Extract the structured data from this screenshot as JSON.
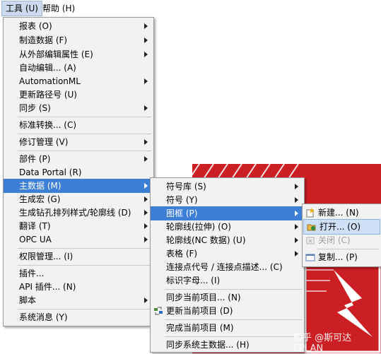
{
  "menubar": {
    "tools": "工具 (U)",
    "help": "帮助 (H)"
  },
  "tools_menu": [
    {
      "label": "报表 (O)",
      "sub": true
    },
    {
      "label": "制造数据 (F)",
      "sub": true
    },
    {
      "label": "从外部编辑属性 (E)",
      "sub": true
    },
    {
      "label": "自动编辑... (A)",
      "sub": false
    },
    {
      "label": "AutomationML",
      "sub": true
    },
    {
      "label": "更新路径号 (U)",
      "sub": false
    },
    {
      "label": "同步 (S)",
      "sub": true
    },
    {
      "label": "标准转换... (C)",
      "sub": false
    },
    {
      "label": "修订管理 (V)",
      "sub": true
    },
    {
      "label": "部件 (P)",
      "sub": true
    },
    {
      "label": "Data Portal (R)",
      "sub": false
    },
    {
      "label": "主数据 (M)",
      "sub": true
    },
    {
      "label": "生成宏 (G)",
      "sub": true
    },
    {
      "label": "生成钻孔排列样式/轮廓线 (D)",
      "sub": true
    },
    {
      "label": "翻译 (T)",
      "sub": true
    },
    {
      "label": "OPC UA",
      "sub": true
    },
    {
      "label": "权限管理... (I)",
      "sub": false
    },
    {
      "label": "插件...",
      "sub": false
    },
    {
      "label": "API 插件... (N)",
      "sub": false
    },
    {
      "label": "脚本",
      "sub": true
    },
    {
      "label": "系统消息 (Y)",
      "sub": false
    }
  ],
  "master_menu": [
    {
      "label": "符号库 (S)",
      "sub": true
    },
    {
      "label": "符号 (Y)",
      "sub": true
    },
    {
      "label": "图框 (P)",
      "sub": true
    },
    {
      "label": "轮廓线(拉伸) (O)",
      "sub": true
    },
    {
      "label": "轮廓线(NC 数据) (U)",
      "sub": true
    },
    {
      "label": "表格 (F)",
      "sub": true
    },
    {
      "label": "连接点代号 / 连接点描述... (C)",
      "sub": false
    },
    {
      "label": "标识字母... (I)",
      "sub": false
    },
    {
      "label": "同步当前项目... (N)",
      "sub": false
    },
    {
      "label": "更新当前项目 (D)",
      "sub": false
    },
    {
      "label": "完成当前项目 (M)",
      "sub": false
    },
    {
      "label": "同步系统主数据... (H)",
      "sub": false
    }
  ],
  "frame_menu": [
    {
      "label": "新建... (N)"
    },
    {
      "label": "打开... (O)"
    },
    {
      "label": "关闭 (C)"
    },
    {
      "label": "复制... (P)"
    }
  ],
  "watermark": "知乎 @斯可达EPLAN",
  "colors": {
    "highlight": "#3d7fd6",
    "backdrop": "#cc1f24",
    "menu_bg": "#f2f2f2"
  }
}
